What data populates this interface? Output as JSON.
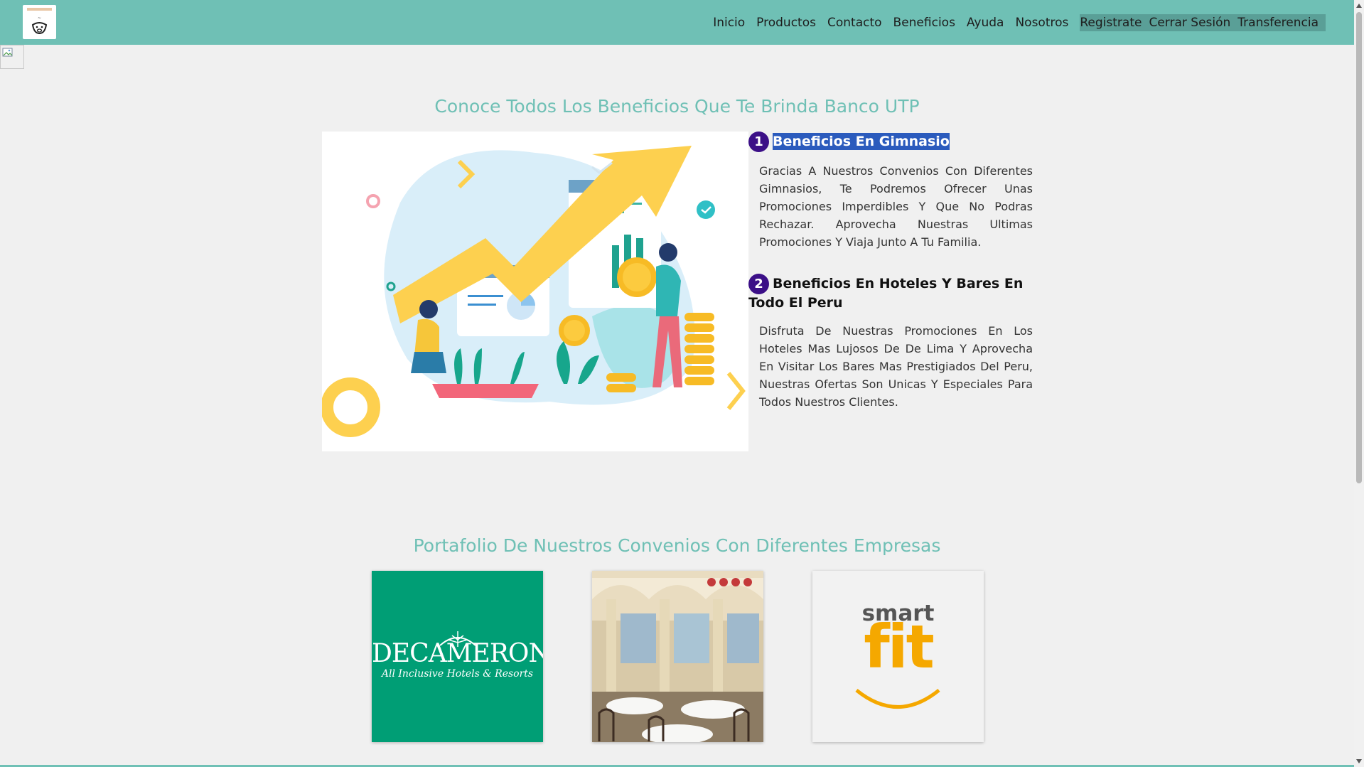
{
  "nav": {
    "items": [
      "Inicio",
      "Productos",
      "Contacto",
      "Beneficios",
      "Ayuda",
      "Nosotros"
    ],
    "account_items": [
      "Registrate",
      "Cerrar Sesión",
      "Transferencia"
    ]
  },
  "sections": {
    "benefits_title": "Conoce Todos Los Beneficios Que Te Brinda Banco UTP",
    "portfolio_title": "Portafolio De Nuestros Convenios Con Diferentes Empresas"
  },
  "benefits": [
    {
      "number": "1",
      "title": "Beneficios En Gimnasio",
      "text": "Gracias A Nuestros Convenios Con Diferentes Gimnasios, Te Podremos Ofrecer Unas Promociones Imperdibles Y Que No Podras Rechazar. Aprovecha Nuestras Ultimas Promociones Y Viaja Junto A Tu Familia."
    },
    {
      "number": "2",
      "title": "Beneficios En Hoteles Y Bares En Todo El Peru",
      "text": "Disfruta De Nuestras Promociones En Los Hoteles Mas Lujosos De De Lima Y Aprovecha En Visitar Los Bares Mas Prestigiados Del Peru, Nuestras Ofertas Son Unicas Y Especiales Para Todos Nuestros Clientes."
    }
  ],
  "partners": {
    "decameron_name": "DECAMERON",
    "decameron_tagline": "All Inclusive Hotels & Resorts",
    "smartfit_top": "smart",
    "smartfit_bottom": "fit"
  },
  "colors": {
    "accent": "#6fc0b5",
    "number_badge": "#3b0f87",
    "decameron_bg": "#009e75",
    "smartfit_orange": "#f5a800"
  }
}
